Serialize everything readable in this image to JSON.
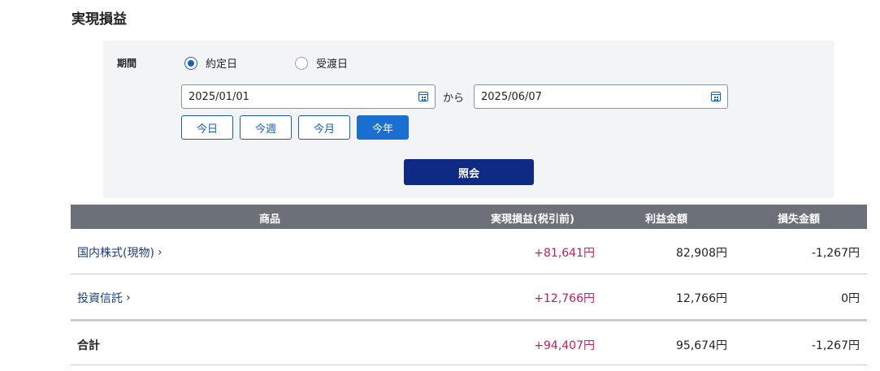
{
  "page": {
    "title": "実現損益"
  },
  "filter": {
    "period_label": "期間",
    "radio_options": [
      {
        "label": "約定日",
        "checked": true
      },
      {
        "label": "受渡日",
        "checked": false
      }
    ],
    "date_from": "2025/01/01",
    "date_to": "2025/06/07",
    "range_separator": "から",
    "quick_buttons": [
      {
        "label": "今日",
        "active": false
      },
      {
        "label": "今週",
        "active": false
      },
      {
        "label": "今月",
        "active": false
      },
      {
        "label": "今年",
        "active": true
      }
    ],
    "submit_label": "照会"
  },
  "table": {
    "headers": {
      "product": "商品",
      "realized_pl": "実現損益(税引前)",
      "gain": "利益金額",
      "loss": "損失金額"
    },
    "rows": [
      {
        "name": "国内株式(現物)",
        "realized_pl": "+81,641円",
        "gain": "82,908円",
        "loss": "-1,267円"
      },
      {
        "name": "投資信託",
        "realized_pl": "+12,766円",
        "gain": "12,766円",
        "loss": "0円"
      }
    ],
    "total": {
      "name": "合計",
      "realized_pl": "+94,407円",
      "gain": "95,674円",
      "loss": "-1,267円"
    }
  },
  "colors": {
    "accent": "#1a5fb4",
    "submit": "#0e2a82",
    "header_bg": "#6b7079",
    "profit_text": "#c1205a",
    "panel_bg": "#f3f4f6"
  }
}
